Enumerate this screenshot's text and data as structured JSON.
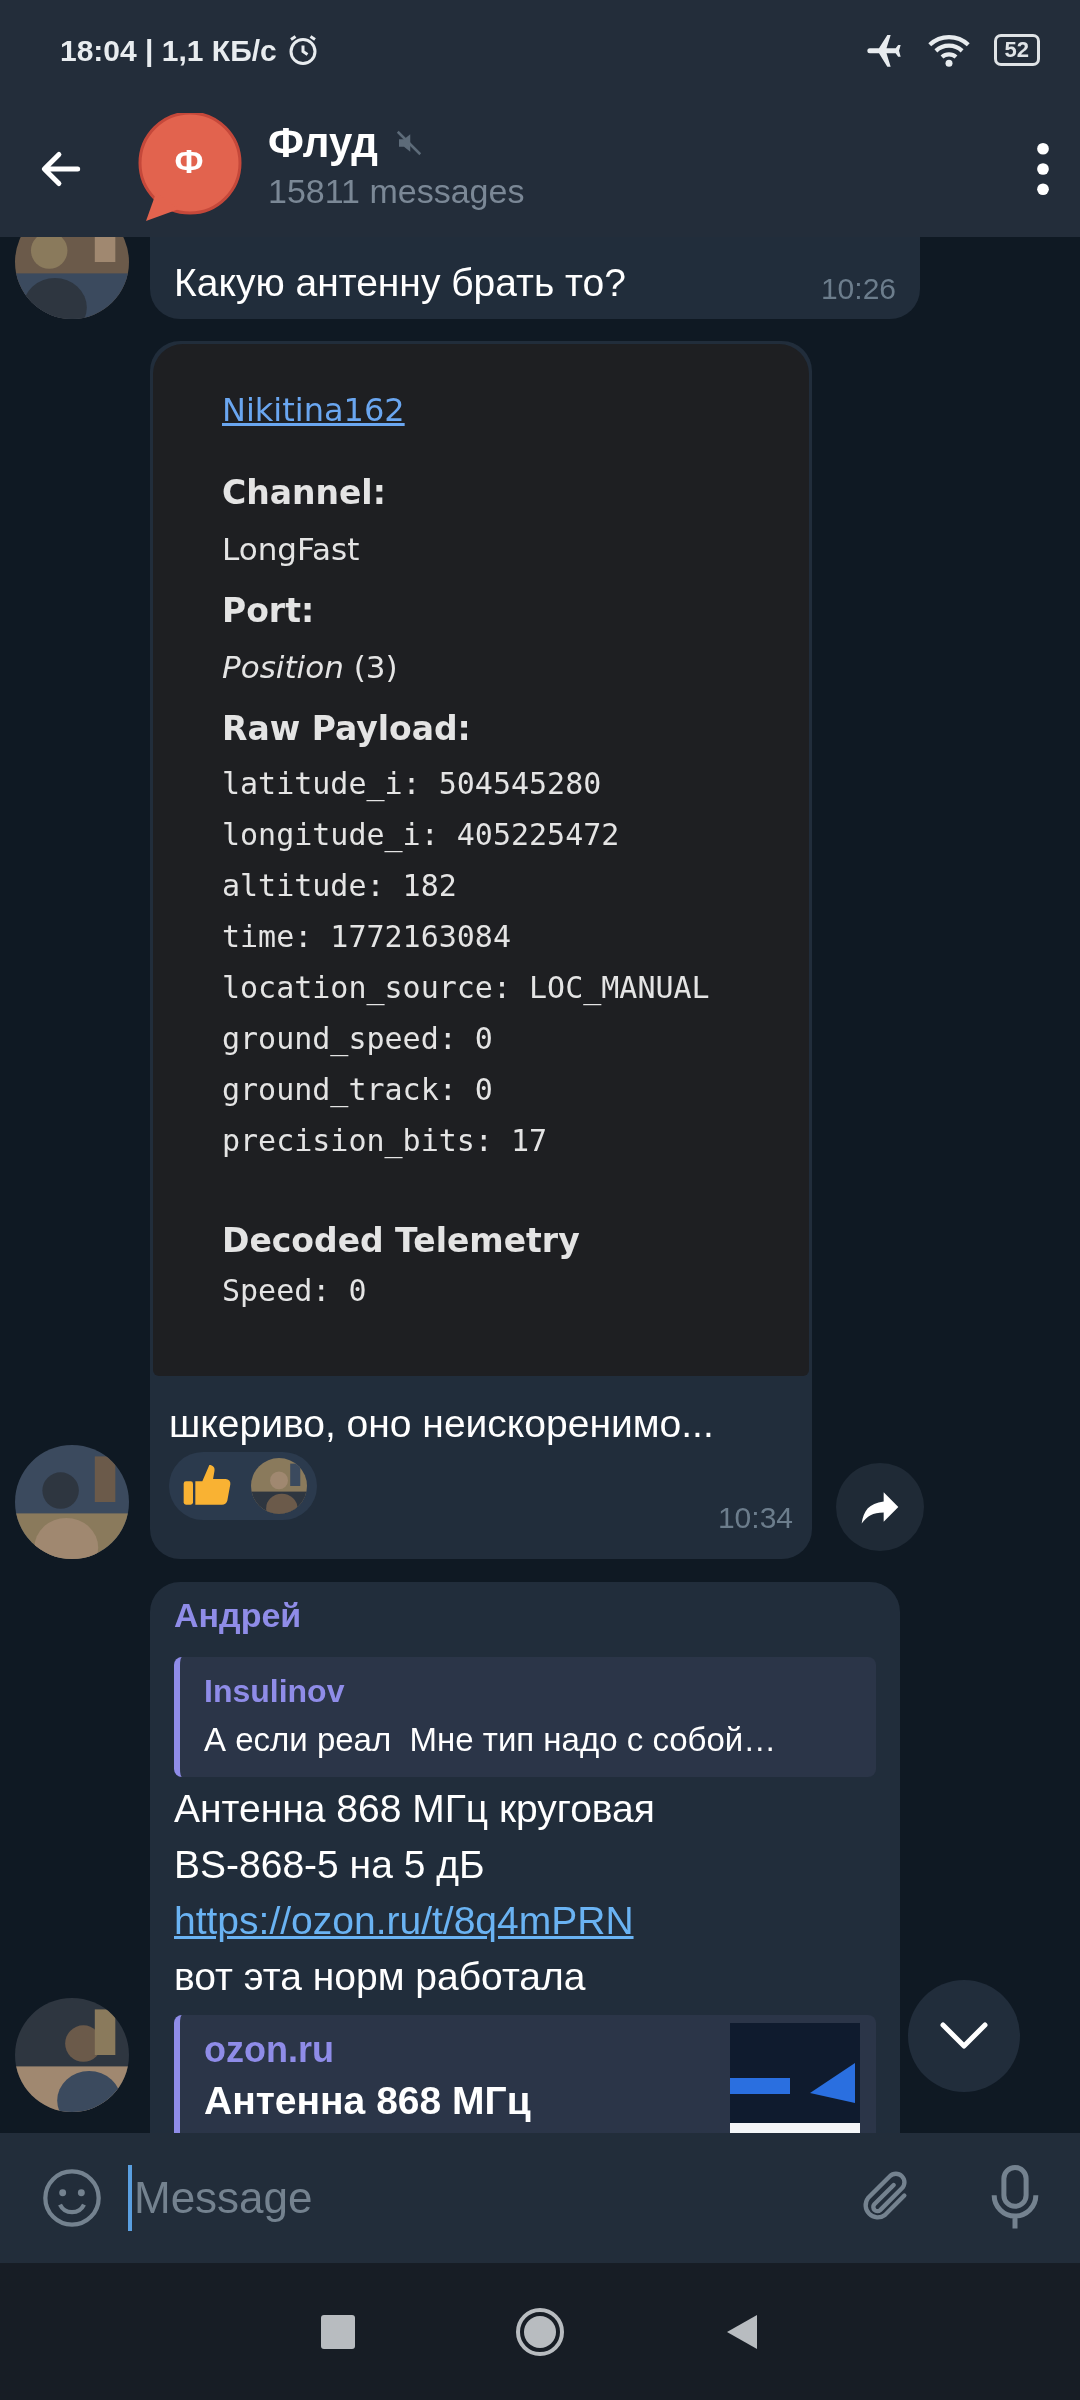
{
  "status_bar": {
    "time": "18:04 | 1,1 КБ/с",
    "battery": "52"
  },
  "header": {
    "avatar_letter": "Ф",
    "title": "Флуд",
    "muted": true,
    "subtitle": "15811 messages"
  },
  "messages": [
    {
      "kind": "text",
      "text": "Какую антенну брать то?",
      "time": "10:26"
    },
    {
      "screenshot": {
        "link": "Nikitina162",
        "fields": [
          {
            "label": "Channel:",
            "value": "LongFast"
          },
          {
            "label": "Port:",
            "value": "*Position* (3)"
          }
        ],
        "raw_title": "Raw Payload:",
        "raw_lines": [
          "latitude_i: 504545280",
          "longitude_i: 405225472",
          "altitude: 182",
          "time: 1772163084",
          "location_source: LOC_MANUAL",
          "ground_speed: 0",
          "ground_track: 0",
          "precision_bits: 17"
        ],
        "decoded_title": "Decoded Telemetry",
        "decoded_lines": [
          "Speed: 0"
        ]
      },
      "caption": "шкериво, оно неискоренимо...",
      "reactions": [
        {
          "kind": "emoji"
        },
        {
          "kind": "avatar"
        }
      ],
      "time": "10:34"
    },
    {
      "kind": "reply",
      "sender": "Андрей",
      "reply": {
        "author": "Insulinov",
        "text": "А если реал  Мне тип надо с собой…"
      },
      "body": [
        {
          "kind": "text",
          "text": "Антенна 868 МГц круговая"
        },
        {
          "kind": "text",
          "text": "BS-868-5 на 5 дБ"
        },
        {
          "kind": "link",
          "text": "https://ozon.ru/t/8q4mPRN"
        },
        {
          "kind": "text",
          "text": "вот эта норм работала"
        }
      ],
      "preview": {
        "site": "ozon.ru",
        "title": "Антенна 868 МГц"
      }
    }
  ],
  "input": {
    "placeholder": "Message"
  }
}
